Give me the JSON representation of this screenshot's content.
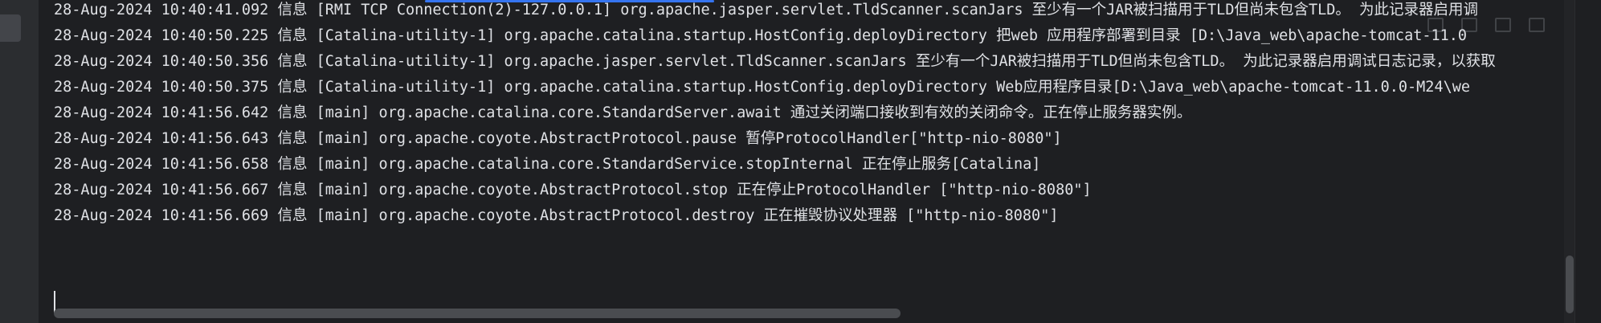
{
  "log_lines": [
    "28-Aug-2024 10:40:41.092 信息 [RMI TCP Connection(2)-127.0.0.1] org.apache.jasper.servlet.TldScanner.scanJars 至少有一个JAR被扫描用于TLD但尚未包含TLD。 为此记录器启用调",
    "28-Aug-2024 10:40:50.225 信息 [Catalina-utility-1] org.apache.catalina.startup.HostConfig.deployDirectory 把web 应用程序部署到目录 [D:\\Java_web\\apache-tomcat-11.0",
    "28-Aug-2024 10:40:50.356 信息 [Catalina-utility-1] org.apache.jasper.servlet.TldScanner.scanJars 至少有一个JAR被扫描用于TLD但尚未包含TLD。 为此记录器启用调试日志记录，以获取",
    "28-Aug-2024 10:40:50.375 信息 [Catalina-utility-1] org.apache.catalina.startup.HostConfig.deployDirectory Web应用程序目录[D:\\Java_web\\apache-tomcat-11.0.0-M24\\we",
    "28-Aug-2024 10:41:56.642 信息 [main] org.apache.catalina.core.StandardServer.await 通过关闭端口接收到有效的关闭命令。正在停止服务器实例。",
    "28-Aug-2024 10:41:56.643 信息 [main] org.apache.coyote.AbstractProtocol.pause 暂停ProtocolHandler[\"http-nio-8080\"]",
    "28-Aug-2024 10:41:56.658 信息 [main] org.apache.catalina.core.StandardService.stopInternal 正在停止服务[Catalina]",
    "28-Aug-2024 10:41:56.667 信息 [main] org.apache.coyote.AbstractProtocol.stop 正在停止ProtocolHandler [\"http-nio-8080\"]",
    "28-Aug-2024 10:41:56.669 信息 [main] org.apache.coyote.AbstractProtocol.destroy 正在摧毁协议处理器 [\"http-nio-8080\"]"
  ],
  "icons": {
    "toolbar": [
      "copy-icon",
      "print-icon",
      "trash-icon",
      "wrap-icon"
    ]
  },
  "colors": {
    "background": "#1e1f22",
    "text": "#dfe1e5",
    "accent": "#3574f0"
  }
}
